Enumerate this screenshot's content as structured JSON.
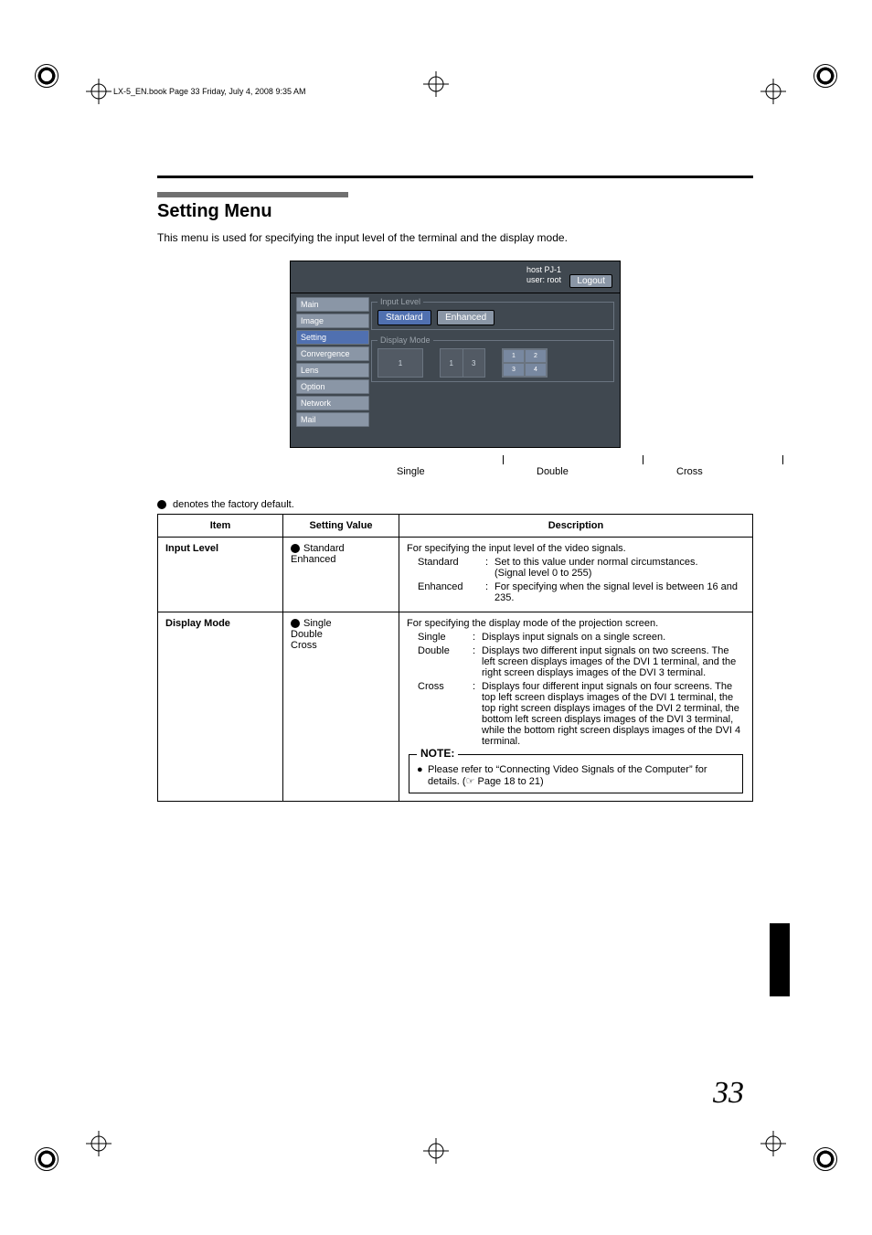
{
  "header_line": "LX-5_EN.book  Page 33  Friday, July 4, 2008  9:35 AM",
  "title": "Setting Menu",
  "intro": "This menu is used for specifying the input level of the terminal and the display mode.",
  "ui": {
    "host": "host PJ-1",
    "user": "user: root",
    "logout": "Logout",
    "nav": [
      "Main",
      "Image",
      "Setting",
      "Convergence",
      "Lens",
      "Option",
      "Network",
      "Mail"
    ],
    "group_input": "Input Level",
    "btn_std": "Standard",
    "btn_enh": "Enhanced",
    "group_mode": "Display Mode",
    "cross_cells": [
      "1",
      "2",
      "3",
      "4"
    ]
  },
  "mode_labels": {
    "single": "Single",
    "double": "Double",
    "cross": "Cross"
  },
  "default_note": " denotes the factory default.",
  "th": {
    "item": "Item",
    "value": "Setting Value",
    "desc": "Description"
  },
  "row1": {
    "item": "Input Level",
    "v1": "Standard",
    "v2": "Enhanced",
    "head": "For specifying the input level of the video signals.",
    "l1": "Standard",
    "t1a": "Set to this value under normal circumstances.",
    "t1b": "(Signal level 0 to 255)",
    "l2": "Enhanced",
    "t2": "For specifying when the signal level is between 16 and 235."
  },
  "row2": {
    "item": "Display Mode",
    "v1": "Single",
    "v2": "Double",
    "v3": "Cross",
    "head": "For specifying the display mode of the projection screen.",
    "l1": "Single",
    "t1": "Displays input signals on a single screen.",
    "l2": "Double",
    "t2": "Displays two different input signals on two screens. The left screen displays images of the DVI 1 terminal, and the right screen displays images of the DVI 3 terminal.",
    "l3": "Cross",
    "t3": "Displays four different input signals on four screens. The top left screen displays images of the DVI 1 terminal, the top right screen displays images of the DVI 2 terminal, the bottom left screen displays images of the DVI 3 terminal, while the bottom right screen displays images of the DVI 4 terminal.",
    "note_title": "NOTE:",
    "note_text": "Please refer to “Connecting Video Signals of the Computer” for details. (☞ Page 18 to 21)"
  },
  "page_number": "33"
}
